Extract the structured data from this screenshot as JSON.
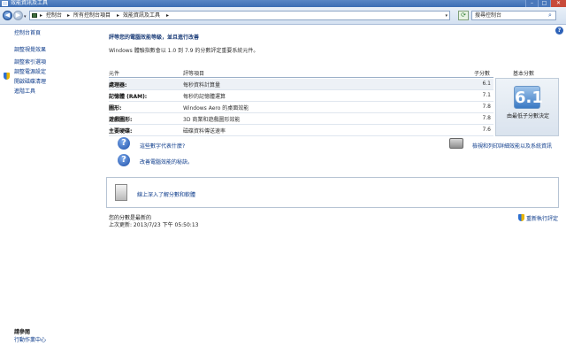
{
  "window": {
    "title": "效能資訊及工具",
    "buttons": {
      "minimize": "–",
      "maximize": "□",
      "close": "✕"
    }
  },
  "address": {
    "segments": [
      "控制台",
      "所有控制台項目",
      "效能資訊及工具"
    ],
    "separator": "▸",
    "search_placeholder": "搜尋控制台"
  },
  "sidebar": {
    "links": [
      "控制台首頁",
      "調整視覺效果",
      "調整索引選項",
      "調整電源設定",
      "開啟磁碟清理",
      "進階工具"
    ],
    "see_also_title": "請參閱",
    "see_also_links": [
      "行動作業中心"
    ]
  },
  "main": {
    "heading": "評等您的電腦效能等級，並且進行改善",
    "description": "Windows 體驗指數會以 1.0 到 7.9 的分數評定重要系統元件。",
    "table": {
      "headers": {
        "component": "元件",
        "rated": "評等項目",
        "subscore": "子分數",
        "basescore": "基本分數"
      },
      "rows": [
        {
          "component": "處理器:",
          "item": "每秒資料計算量",
          "subscore": "6.1"
        },
        {
          "component": "記憶體 (RAM):",
          "item": "每秒的記憶體運算",
          "subscore": "7.1"
        },
        {
          "component": "圖形:",
          "item": "Windows Aero 的桌面效能",
          "subscore": "7.8"
        },
        {
          "component": "遊戲圖形:",
          "item": "3D 商業和遊戲圖形效能",
          "subscore": "7.8"
        },
        {
          "component": "主要硬碟:",
          "item": "磁碟資料傳送速率",
          "subscore": "7.6"
        }
      ],
      "base_score": "6.1",
      "base_caption": "由最低子分數決定"
    },
    "links": {
      "what_numbers": "這些數字代表什麼?",
      "improve": "改善電腦效能的秘訣。",
      "print": "檢視和列印詳細效能以及系統資訊"
    },
    "learn_more": "線上深入了解分數和軟體",
    "status": {
      "current": "您的分數是最新的",
      "last_update": "上次更新: 2013/7/23 下午 05:50:13"
    },
    "rerun": "重新執行評定",
    "help": "?"
  },
  "colors": {
    "accent": "#2d62b8",
    "link": "#0b3a8a",
    "titlebar": "#3b6db4"
  },
  "icons": [
    "back-arrow-icon",
    "forward-arrow-icon",
    "control-panel-icon",
    "refresh-icon",
    "search-icon",
    "shield-icon",
    "help-icon",
    "question-icon",
    "printer-icon",
    "recycle-bin-icon"
  ]
}
